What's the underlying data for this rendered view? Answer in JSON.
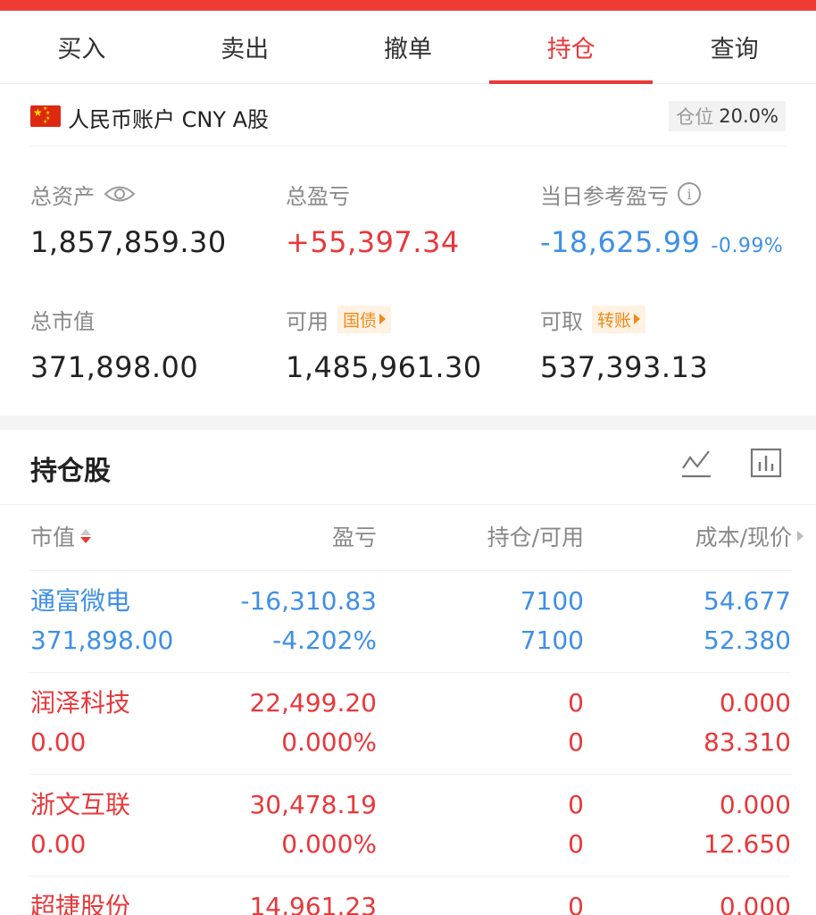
{
  "tabs": [
    {
      "label": "买入",
      "active": false
    },
    {
      "label": "卖出",
      "active": false
    },
    {
      "label": "撤单",
      "active": false
    },
    {
      "label": "持仓",
      "active": true
    },
    {
      "label": "查询",
      "active": false
    }
  ],
  "account": {
    "flag_icon": "china-flag-icon",
    "name": "人民币账户 CNY A股",
    "position_label": "仓位",
    "position_value": "20.0%"
  },
  "summary": {
    "total_assets_label": "总资产",
    "total_assets": "1,857,859.30",
    "total_pnl_label": "总盈亏",
    "total_pnl": "+55,397.34",
    "daily_pnl_label": "当日参考盈亏",
    "daily_pnl": "-18,625.99",
    "daily_pnl_pct": "-0.99%",
    "market_value_label": "总市值",
    "market_value": "371,898.00",
    "available_label": "可用",
    "available_tag": "国债",
    "available": "1,485,961.30",
    "withdrawable_label": "可取",
    "withdrawable_tag": "转账",
    "withdrawable": "537,393.13"
  },
  "holdings": {
    "title": "持仓股",
    "columns": {
      "market_value": "市值",
      "pnl": "盈亏",
      "qty": "持仓/可用",
      "price": "成本/现价"
    },
    "rows": [
      {
        "name": "通富微电",
        "market_value": "371,898.00",
        "pnl": "-16,310.83",
        "pnl_pct": "-4.202%",
        "hold": "7100",
        "available": "7100",
        "cost": "54.677",
        "price": "52.380",
        "color": "blue"
      },
      {
        "name": "润泽科技",
        "market_value": "0.00",
        "pnl": "22,499.20",
        "pnl_pct": "0.000%",
        "hold": "0",
        "available": "0",
        "cost": "0.000",
        "price": "83.310",
        "color": "red"
      },
      {
        "name": "浙文互联",
        "market_value": "0.00",
        "pnl": "30,478.19",
        "pnl_pct": "0.000%",
        "hold": "0",
        "available": "0",
        "cost": "0.000",
        "price": "12.650",
        "color": "red"
      },
      {
        "name": "超捷股份",
        "market_value": "",
        "pnl": "14,961.23",
        "pnl_pct": "",
        "hold": "0",
        "available": "",
        "cost": "0.000",
        "price": "",
        "color": "red"
      }
    ]
  },
  "colors": {
    "accent_red": "#e8383b",
    "loss_blue": "#3f8fe6",
    "tag_orange": "#f08a1a"
  }
}
